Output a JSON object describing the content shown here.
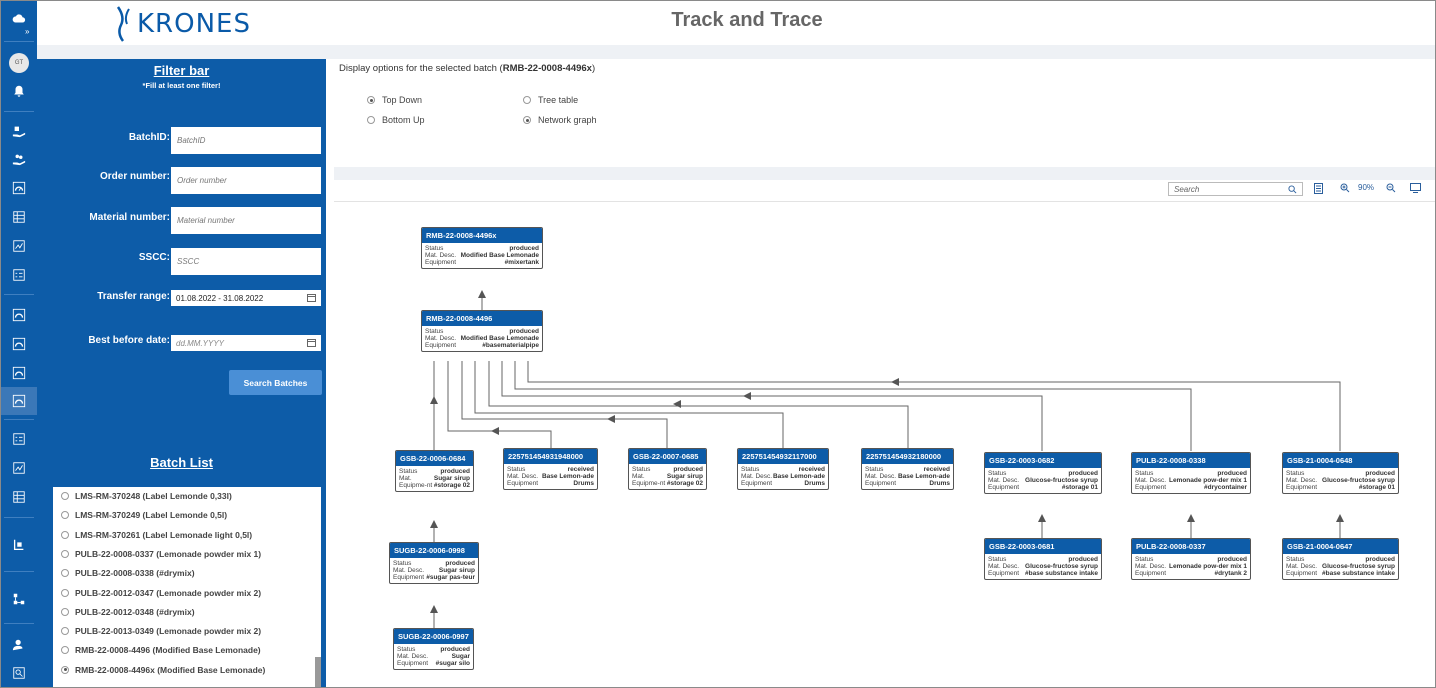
{
  "header": {
    "logo_text": "KRONES",
    "title": "Track and Trace",
    "user_initials": "GT"
  },
  "filter": {
    "title": "Filter bar",
    "subtitle": "*Fill at least one filter!",
    "batch_id_label": "BatchID:",
    "batch_id_placeholder": "BatchID",
    "order_label": "Order number:",
    "order_placeholder": "Order number",
    "material_label": "Material number:",
    "material_placeholder": "Material number",
    "sscc_label": "SSCC:",
    "sscc_placeholder": "SSCC",
    "transfer_label": "Transfer range:",
    "transfer_value": "01.08.2022 - 31.08.2022",
    "bbd_label": "Best before date:",
    "bbd_placeholder": "dd.MM.YYYY",
    "search_button": "Search Batches"
  },
  "batch_list": {
    "title": "Batch List",
    "items": [
      {
        "label": "LMS-RM-370248 (Label Lemonde 0,33l)",
        "selected": false
      },
      {
        "label": "LMS-RM-370249 (Label Lemonde 0,5l)",
        "selected": false
      },
      {
        "label": "LMS-RM-370261 (Label Lemonade light 0,5l)",
        "selected": false
      },
      {
        "label": "PULB-22-0008-0337 (Lemonade powder mix 1)",
        "selected": false
      },
      {
        "label": "PULB-22-0008-0338 (#drymix)",
        "selected": false
      },
      {
        "label": "PULB-22-0012-0347 (Lemonade powder mix 2)",
        "selected": false
      },
      {
        "label": "PULB-22-0012-0348 (#drymix)",
        "selected": false
      },
      {
        "label": "PULB-22-0013-0349 (Lemonade powder mix 2)",
        "selected": false
      },
      {
        "label": "RMB-22-0008-4496 (Modified Base Lemonade)",
        "selected": false
      },
      {
        "label": "RMB-22-0008-4496x (Modified Base Lemonade)",
        "selected": true
      }
    ]
  },
  "display": {
    "title_prefix": "Display options for the selected batch (",
    "batch": "RMB-22-0008-4496x",
    "title_suffix": ")",
    "options": {
      "top_down": "Top Down",
      "bottom_up": "Bottom Up",
      "tree_table": "Tree table",
      "network_graph": "Network graph"
    },
    "selected_direction": "Top Down",
    "selected_view": "Network graph"
  },
  "toolbar": {
    "search_placeholder": "Search",
    "zoom": "90%"
  },
  "graph": {
    "nodes": [
      {
        "id": "RMB-22-0008-4496x",
        "rows": [
          [
            "Status",
            "produced"
          ],
          [
            "Mat. Desc.",
            "Modified Base Lemonade"
          ],
          [
            "Equipment",
            "#mixertank"
          ]
        ]
      },
      {
        "id": "RMB-22-0008-4496",
        "rows": [
          [
            "Status",
            "produced"
          ],
          [
            "Mat. Desc.",
            "Modified Base Lemonade"
          ],
          [
            "Equipment",
            "#basematerialpipe"
          ]
        ]
      },
      {
        "id": "GSB-22-0006-0684",
        "rows": [
          [
            "Status",
            "produced"
          ],
          [
            "Mat.",
            "Sugar sirup"
          ],
          [
            "Equipme-nt",
            "#storage 02"
          ]
        ]
      },
      {
        "id": "225751454931948000",
        "rows": [
          [
            "Status",
            "received"
          ],
          [
            "Mat. Desc.",
            "Base Lemon-ade"
          ],
          [
            "Equipment",
            "Drums"
          ]
        ]
      },
      {
        "id": "GSB-22-0007-0685",
        "rows": [
          [
            "Status",
            "produced"
          ],
          [
            "Mat.",
            "Sugar sirup"
          ],
          [
            "Equipme-nt",
            "#storage 02"
          ]
        ]
      },
      {
        "id": "225751454932117000",
        "rows": [
          [
            "Status",
            "received"
          ],
          [
            "Mat. Desc.",
            "Base Lemon-ade"
          ],
          [
            "Equipment",
            "Drums"
          ]
        ]
      },
      {
        "id": "225751454932180000",
        "rows": [
          [
            "Status",
            "received"
          ],
          [
            "Mat. Desc.",
            "Base Lemon-ade"
          ],
          [
            "Equipment",
            "Drums"
          ]
        ]
      },
      {
        "id": "GSB-22-0003-0682",
        "rows": [
          [
            "Status",
            "produced"
          ],
          [
            "Mat. Desc.",
            "Glucose-fructose syrup"
          ],
          [
            "Equipment",
            "#storage 01"
          ]
        ]
      },
      {
        "id": "PULB-22-0008-0338",
        "rows": [
          [
            "Status",
            "produced"
          ],
          [
            "Mat. Desc.",
            "Lemonade pow-der mix 1"
          ],
          [
            "Equipment",
            "#drycontainer"
          ]
        ]
      },
      {
        "id": "GSB-21-0004-0648",
        "rows": [
          [
            "Status",
            "produced"
          ],
          [
            "Mat. Desc.",
            "Glucose-fructose syrup"
          ],
          [
            "Equipment",
            "#storage 01"
          ]
        ]
      },
      {
        "id": "SUGB-22-0006-0998",
        "rows": [
          [
            "Status",
            "produced"
          ],
          [
            "Mat. Desc.",
            "Sugar sirup"
          ],
          [
            "Equipment",
            "#sugar pas-teur"
          ]
        ]
      },
      {
        "id": "GSB-22-0003-0681",
        "rows": [
          [
            "Status",
            "produced"
          ],
          [
            "Mat. Desc.",
            "Glucose-fructose syrup"
          ],
          [
            "Equipment",
            "#base substance intake"
          ]
        ]
      },
      {
        "id": "PULB-22-0008-0337",
        "rows": [
          [
            "Status",
            "produced"
          ],
          [
            "Mat. Desc.",
            "Lemonade pow-der mix 1"
          ],
          [
            "Equipment",
            "#drytank 2"
          ]
        ]
      },
      {
        "id": "GSB-21-0004-0647",
        "rows": [
          [
            "Status",
            "produced"
          ],
          [
            "Mat. Desc.",
            "Glucose-fructose syrup"
          ],
          [
            "Equipment",
            "#base substance intake"
          ]
        ]
      },
      {
        "id": "SUGB-22-0006-0997",
        "rows": [
          [
            "Status",
            "produced"
          ],
          [
            "Mat. Desc.",
            "Sugar"
          ],
          [
            "Equipment",
            "#sugar silo"
          ]
        ]
      }
    ]
  }
}
